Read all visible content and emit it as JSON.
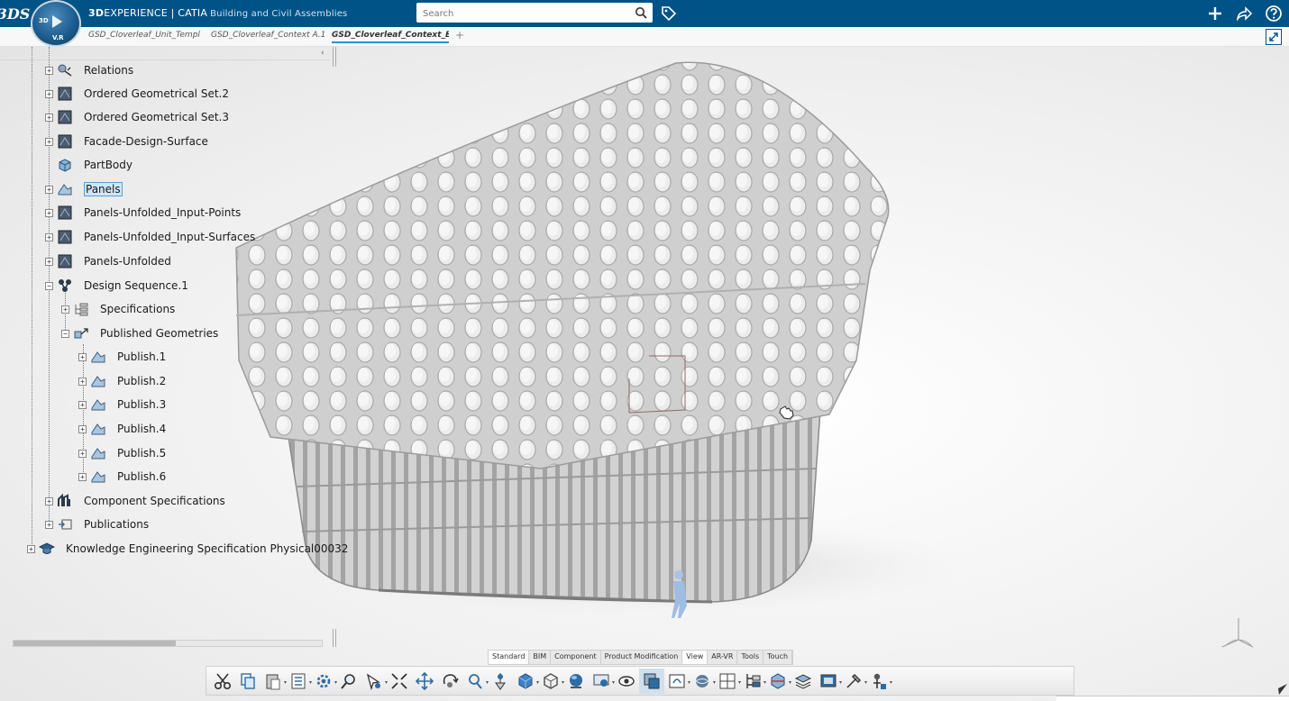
{
  "app": {
    "logo_text": "3DS",
    "compass": {
      "left": "3D",
      "center": "V.R",
      "top": "",
      "right": ""
    },
    "brand_bold": "3D",
    "brand_rest": "EXPERIENCE | CATIA",
    "brand_sub": "Building and Civil Assemblies"
  },
  "search": {
    "placeholder": "Search",
    "value": ""
  },
  "tabs": [
    {
      "label": "GSD_Cloverleaf_Unit_Templ"
    },
    {
      "label": "GSD_Cloverleaf_Context A.1"
    },
    {
      "label": "GSD_Cloverleaf_Context_B"
    }
  ],
  "tab_add": "+",
  "tree": {
    "items": [
      {
        "label": "Relations"
      },
      {
        "label": "Ordered Geometrical Set.2"
      },
      {
        "label": "Ordered Geometrical Set.3"
      },
      {
        "label": "Facade-Design-Surface"
      },
      {
        "label": "PartBody"
      },
      {
        "label": "Panels"
      },
      {
        "label": "Panels-Unfolded_Input-Points"
      },
      {
        "label": "Panels-Unfolded_Input-Surfaces"
      },
      {
        "label": "Panels-Unfolded"
      },
      {
        "label": "Design Sequence.1"
      },
      {
        "label": "Specifications"
      },
      {
        "label": "Published Geometries"
      },
      {
        "label": "Publish.1"
      },
      {
        "label": "Publish.2"
      },
      {
        "label": "Publish.3"
      },
      {
        "label": "Publish.4"
      },
      {
        "label": "Publish.5"
      },
      {
        "label": "Publish.6"
      },
      {
        "label": "Component Specifications"
      },
      {
        "label": "Publications"
      },
      {
        "label": "Knowledge Engineering Specification Physical00032"
      }
    ]
  },
  "action_bar": {
    "tabs": [
      {
        "label": "Standard"
      },
      {
        "label": "BIM"
      },
      {
        "label": "Component"
      },
      {
        "label": "Product Modification"
      },
      {
        "label": "View"
      },
      {
        "label": "AR-VR"
      },
      {
        "label": "Tools"
      },
      {
        "label": "Touch"
      }
    ]
  },
  "colors": {
    "topbar": "#005386",
    "selection": "#cfe6f7",
    "accent": "#2c8fd2"
  }
}
